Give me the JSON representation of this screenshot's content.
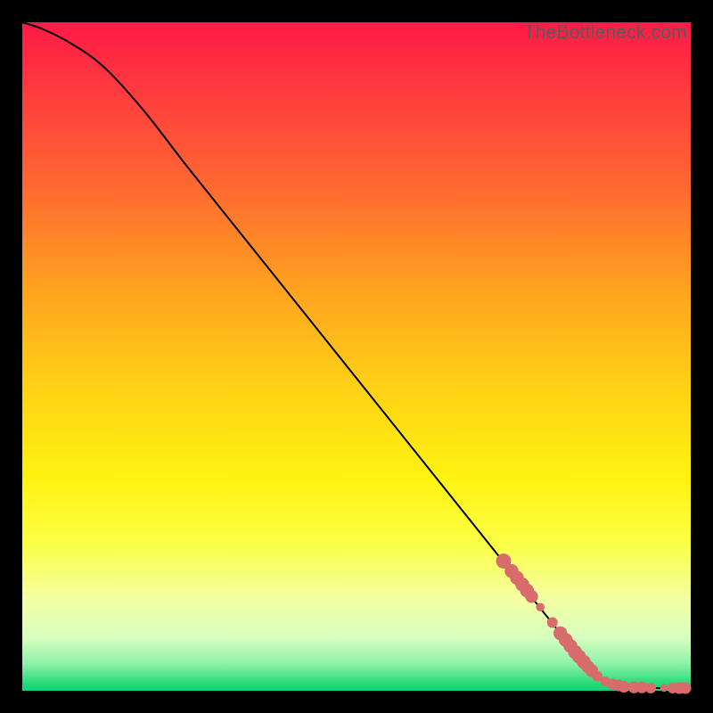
{
  "watermark": "TheBottleneck.com",
  "chart_data": {
    "type": "line",
    "title": "",
    "xlabel": "",
    "ylabel": "",
    "xlim": [
      0,
      100
    ],
    "ylim": [
      0,
      100
    ],
    "curve": {
      "x": [
        0,
        3,
        7,
        12,
        18,
        25,
        35,
        45,
        55,
        65,
        73,
        80,
        84,
        86,
        88,
        90,
        92,
        95,
        97,
        100
      ],
      "y": [
        100,
        99,
        97,
        93.5,
        87,
        78,
        65.5,
        53,
        40.5,
        28,
        18,
        9.2,
        4.2,
        2.2,
        1.2,
        0.7,
        0.5,
        0.4,
        0.4,
        0.4
      ]
    },
    "markers": {
      "x": [
        72,
        73.2,
        74,
        74.8,
        75.5,
        76.2,
        77.5,
        79.3,
        80.5,
        81.3,
        82,
        82.7,
        83.3,
        84,
        84.6,
        85.2,
        86,
        87.2,
        88.3,
        89.2,
        90,
        91.5,
        92.7,
        94,
        96,
        97.3,
        98.3,
        99.2
      ],
      "y": [
        19.4,
        17.9,
        16.9,
        15.9,
        15.0,
        14.1,
        12.5,
        10.2,
        8.6,
        7.6,
        6.7,
        5.8,
        5.1,
        4.3,
        3.6,
        3.0,
        2.2,
        1.4,
        1.0,
        0.8,
        0.6,
        0.5,
        0.5,
        0.4,
        0.4,
        0.4,
        0.4,
        0.4
      ],
      "r": [
        1.4,
        1.3,
        1.3,
        1.3,
        1.3,
        1.2,
        0.8,
        1.0,
        1.3,
        1.3,
        1.3,
        1.3,
        1.3,
        1.3,
        1.2,
        1.2,
        1.0,
        0.9,
        1.0,
        1.1,
        1.1,
        1.1,
        1.1,
        1.0,
        0.7,
        1.0,
        1.1,
        1.1
      ]
    },
    "marker_color": "#d86b6b",
    "line_color": "#000000"
  }
}
